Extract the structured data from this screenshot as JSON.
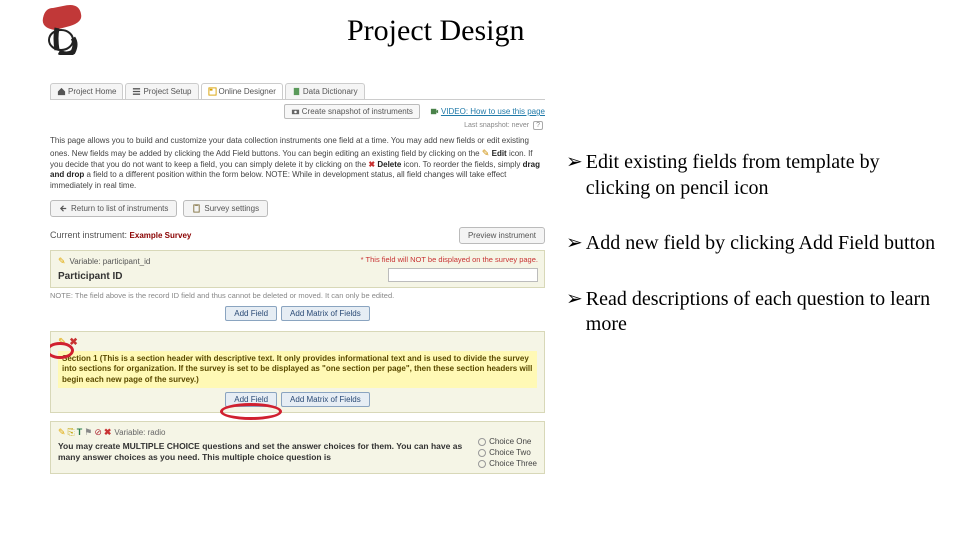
{
  "slide": {
    "title": "Project Design"
  },
  "tabs": {
    "home": "Project Home",
    "setup": "Project Setup",
    "designer": "Online Designer",
    "dictionary": "Data Dictionary"
  },
  "toolbar": {
    "snapshot": "Create snapshot of instruments",
    "video": "VIDEO: How to use this page",
    "last_snapshot": "Last snapshot: never"
  },
  "description": {
    "l1a": "This page allows you to build and customize your data collection instruments one field at a time. You may add new fields or edit existing ones. New fields may be added by clicking the Add Field buttons. You can begin editing an existing field by clicking on the ",
    "edit_word": "Edit",
    "l1b": " icon. If you decide that you do not want to keep a field, you can simply delete it by clicking on the ",
    "delete_word": "Delete",
    "l1c": " icon. To reorder the fields, simply ",
    "drag_word": "drag and drop",
    "l1d": " a field to a different position within the form below. NOTE: While in development status, all field changes will take effect immediately in real time."
  },
  "buttons": {
    "return": "Return to list of instruments",
    "survey_settings": "Survey settings",
    "preview": "Preview instrument",
    "add_field": "Add Field",
    "add_matrix": "Add Matrix of Fields"
  },
  "instrument": {
    "label": "Current instrument: ",
    "name": "Example Survey"
  },
  "field1": {
    "variable": "Variable: participant_id",
    "no_display": "* This field will NOT be displayed on the survey page.",
    "label": "Participant ID",
    "note": "NOTE: The field above is the record ID field and thus cannot be deleted or moved. It can only be edited."
  },
  "section_header": {
    "text": "Section 1 (This is a section header with descriptive text. It only provides informational text and is used to divide the survey into sections for organization. If the survey is set to be displayed as \"one section per page\", then these section headers will begin each new page of the survey.)"
  },
  "mc_field": {
    "variable": "Variable: radio",
    "desc": "You may create MULTIPLE CHOICE questions and set the answer choices for them. You can have as many answer choices as you need. This multiple choice question is",
    "options": [
      "Choice One",
      "Choice Two",
      "Choice Three"
    ]
  },
  "bullets": {
    "b1": "Edit existing fields from template by clicking on pencil icon",
    "b2": "Add new field by clicking Add Field button",
    "b3": "Read descriptions of each question to learn more"
  },
  "help_icon": "?"
}
